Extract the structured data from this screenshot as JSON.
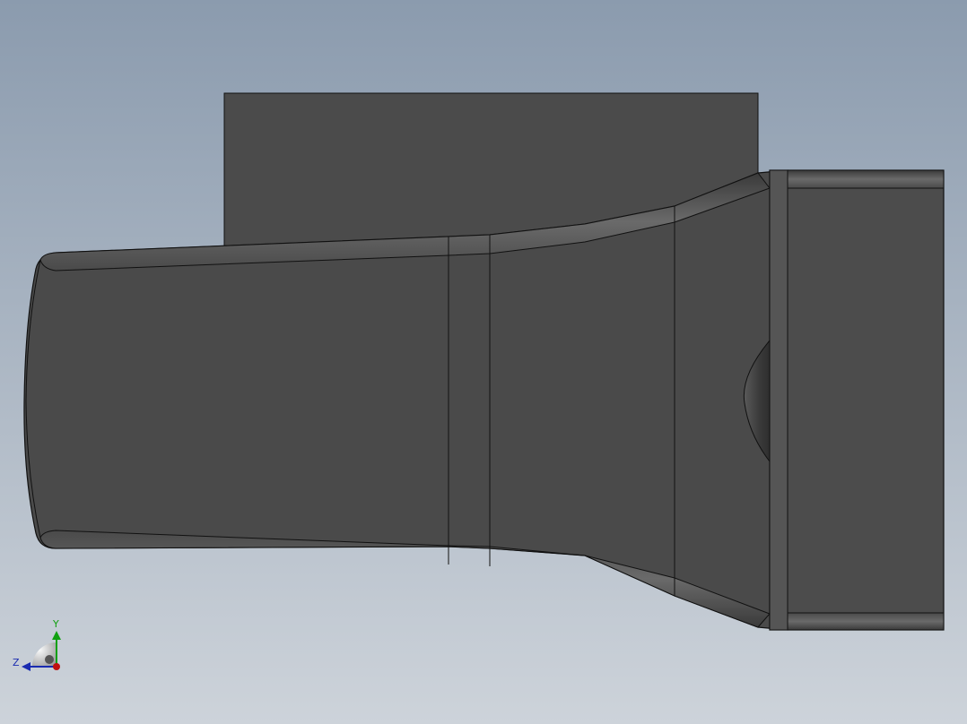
{
  "viewport": {
    "background_top": "#8b9bae",
    "background_bottom": "#cdd3da"
  },
  "model": {
    "face_color": "#4a4a4a",
    "face_color_light": "#505050",
    "back_block_color": "#4b4b4b",
    "edge_color": "#111111",
    "fillet_highlight": "#6e6e6e"
  },
  "triad": {
    "y_label": "Y",
    "z_label": "Z",
    "y_color": "#10a010",
    "z_color": "#1a2bb0",
    "x_color": "#c01010"
  }
}
